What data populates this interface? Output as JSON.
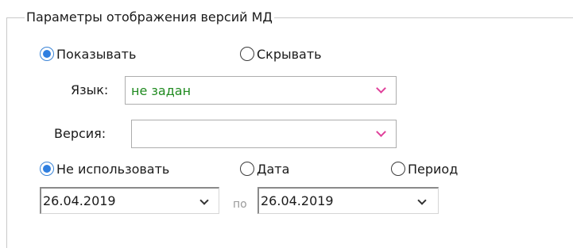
{
  "group": {
    "title": "Параметры отображения версий МД"
  },
  "display_mode": {
    "show_label": "Показывать",
    "hide_label": "Скрывать",
    "selected": "show"
  },
  "language": {
    "label": "Язык:",
    "value": "не задан",
    "value_color": "#1f8a1f"
  },
  "version": {
    "label": "Версия:",
    "value": ""
  },
  "date_mode": {
    "none_label": "Не использовать",
    "date_label": "Дата",
    "period_label": "Период",
    "selected": "none"
  },
  "period": {
    "from": "26.04.2019",
    "separator": "по",
    "to": "26.04.2019"
  },
  "colors": {
    "accent": "#2f7fe0",
    "dropdown_arrow": "#e0409a"
  }
}
